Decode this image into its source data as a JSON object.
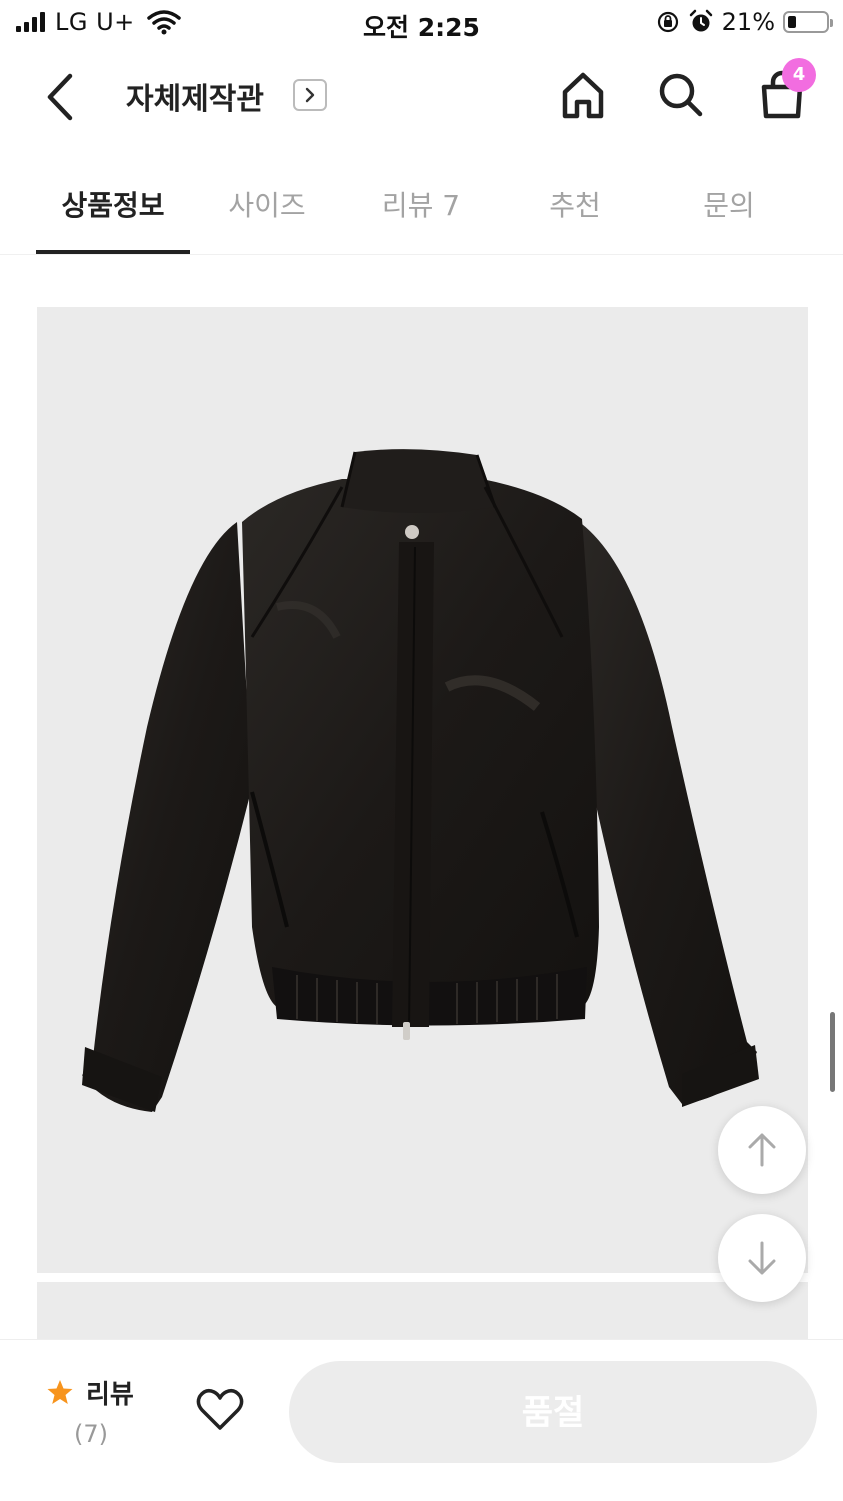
{
  "status_bar": {
    "carrier": "LG U+",
    "time": "오전 2:25",
    "battery_percent": "21%",
    "battery_level": 0.21
  },
  "header": {
    "store_name": "자체제작관",
    "cart_count": "4",
    "icons": [
      "chevron-left-icon",
      "chevron-right-icon",
      "home-icon",
      "search-icon",
      "shopping-bag-icon"
    ]
  },
  "tabs": [
    {
      "label": "상품정보",
      "active": true
    },
    {
      "label": "사이즈",
      "active": false
    },
    {
      "label": "리뷰 7",
      "active": false
    },
    {
      "label": "추천",
      "active": false
    },
    {
      "label": "문의",
      "active": false
    }
  ],
  "bottom_bar": {
    "review_label": "리뷰",
    "review_count": "(7)",
    "buy_button_label": "품절"
  },
  "colors": {
    "badge": "#f26de0",
    "star": "#f7941d",
    "image_background": "#ebebeb",
    "jacket": "#1f1c1a"
  }
}
